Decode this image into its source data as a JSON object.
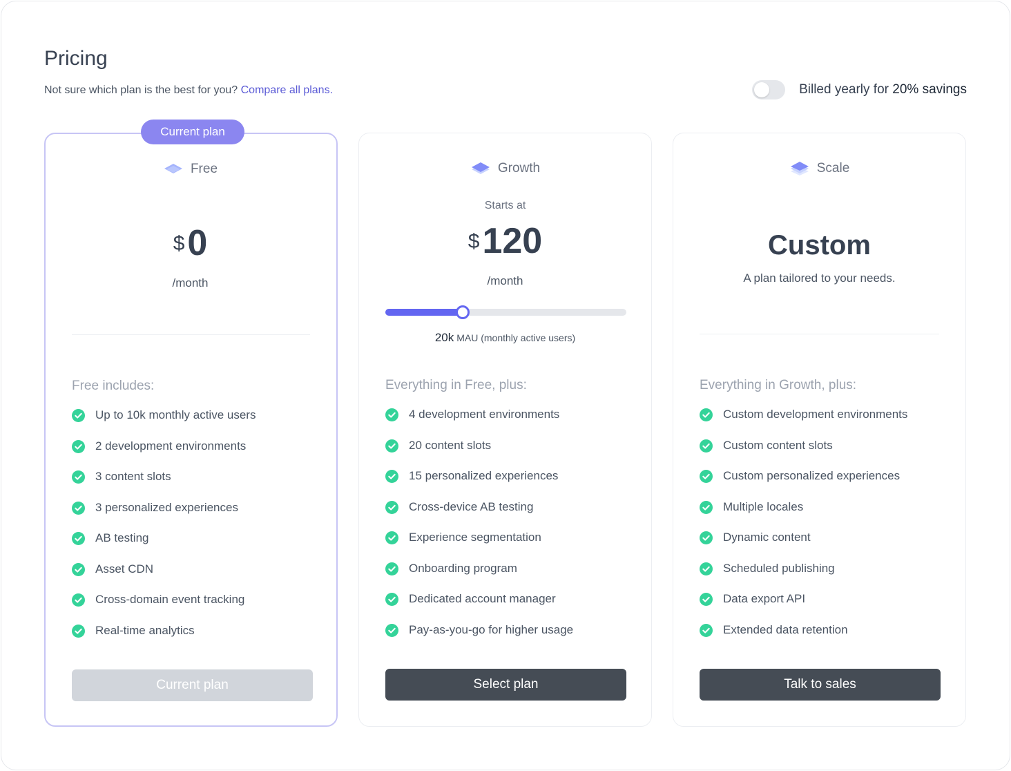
{
  "header": {
    "title": "Pricing",
    "subtitle": "Not sure which plan is the best for you?",
    "compare_link": "Compare all plans.",
    "billing_prefix": "Billed yearly for",
    "billing_savings": "20% savings",
    "billed_yearly": false
  },
  "colors": {
    "accent": "#6366f1",
    "badge": "#8b86f0",
    "check": "#34d399",
    "button_dark": "#454c55",
    "button_disabled": "#d1d5db"
  },
  "plans": {
    "free": {
      "badge": "Current plan",
      "name": "Free",
      "currency": "$",
      "price": "0",
      "period": "/month",
      "includes_title": "Free includes:",
      "features": [
        "Up to 10k monthly active users",
        "2 development environments",
        "3 content slots",
        "3 personalized experiences",
        "AB testing",
        "Asset CDN",
        "Cross-domain event tracking",
        "Real-time analytics"
      ],
      "button": "Current plan"
    },
    "growth": {
      "name": "Growth",
      "starts_at": "Starts at",
      "currency": "$",
      "price": "120",
      "period": "/month",
      "slider_fraction": 0.32,
      "mau_value": "20k",
      "mau_label": "MAU (monthly active users)",
      "includes_title": "Everything in Free, plus:",
      "features": [
        "4 development environments",
        "20 content slots",
        "15 personalized experiences",
        "Cross-device AB testing",
        "Experience segmentation",
        "Onboarding program",
        "Dedicated account manager",
        "Pay-as-you-go for higher usage"
      ],
      "button": "Select plan"
    },
    "scale": {
      "name": "Scale",
      "title": "Custom",
      "subtitle": "A plan tailored to your needs.",
      "includes_title": "Everything in Growth, plus:",
      "features": [
        "Custom development environments",
        "Custom content slots",
        "Custom personalized experiences",
        "Multiple locales",
        "Dynamic content",
        "Scheduled publishing",
        "Data export API",
        "Extended data retention"
      ],
      "button": "Talk to sales"
    }
  }
}
